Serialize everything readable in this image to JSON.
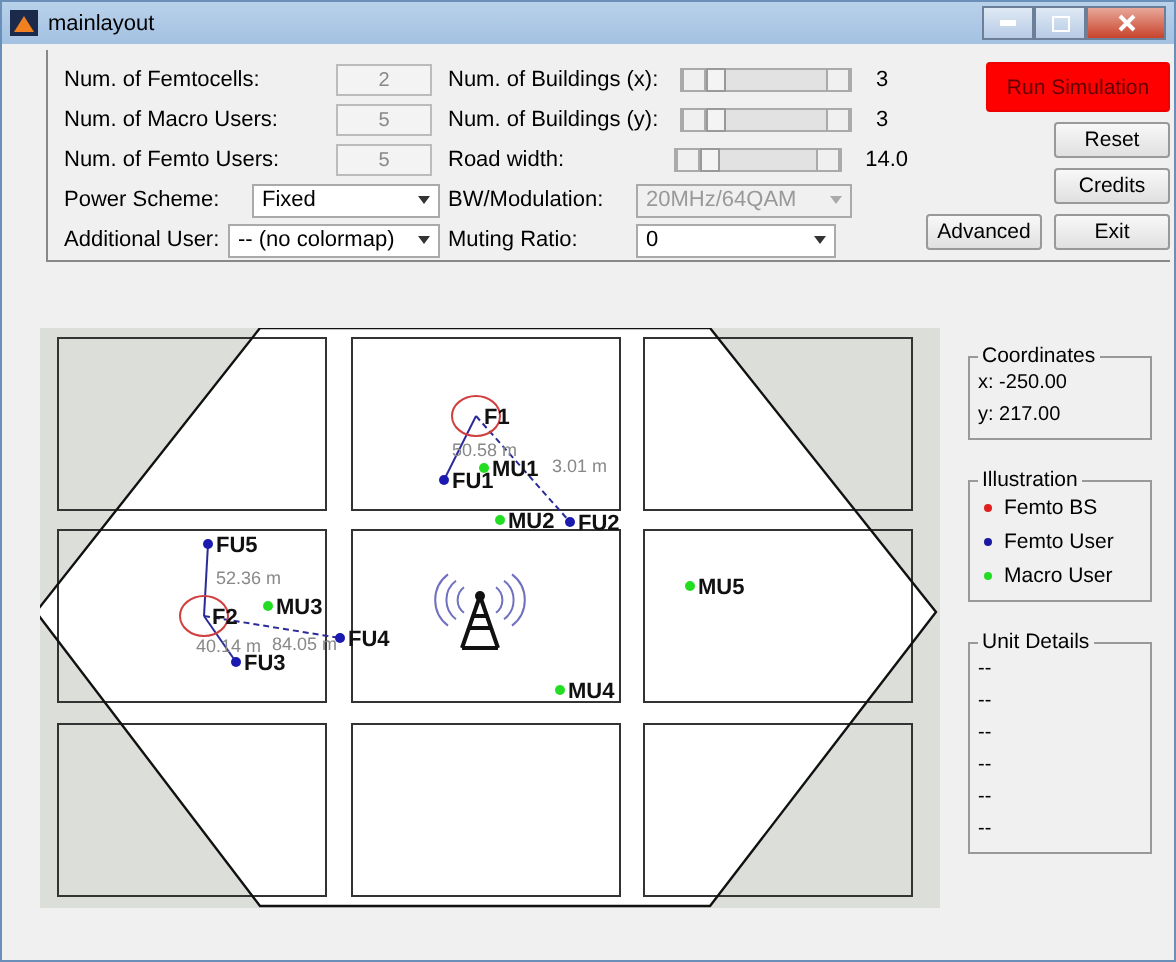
{
  "window": {
    "title": "mainlayout"
  },
  "settings_left": [
    {
      "kind": "number",
      "label": "Num. of Femtocells:",
      "value": "2",
      "disabled": true
    },
    {
      "kind": "number",
      "label": "Num. of Macro Users:",
      "value": "5",
      "disabled": true
    },
    {
      "kind": "number",
      "label": "Num. of Femto Users:",
      "value": "5",
      "disabled": true
    },
    {
      "kind": "dropdown",
      "label": "Power Scheme:",
      "value": "Fixed",
      "disabled": false
    },
    {
      "kind": "dropdown",
      "label": "Additional User:",
      "value": "-- (no colormap)",
      "disabled": false
    }
  ],
  "settings_right": [
    {
      "kind": "slider",
      "label": "Num. of Buildings (x):",
      "level": 0,
      "reading": "3"
    },
    {
      "kind": "slider",
      "label": "Num. of Buildings (y):",
      "level": 0,
      "reading": "3"
    },
    {
      "kind": "slider",
      "label": "Road width:",
      "level": 0,
      "reading": "14.0"
    },
    {
      "kind": "dropdown",
      "label": "BW/Modulation:",
      "value": "20MHz/64QAM",
      "disabled": true
    },
    {
      "kind": "dropdown",
      "label": "Muting Ratio:",
      "value": "0",
      "disabled": false
    }
  ],
  "buttons": [
    {
      "label": "Run Simulation",
      "kind": "run"
    },
    {
      "label": "Reset",
      "kind": "normal"
    },
    {
      "label": "Credits",
      "kind": "normal"
    },
    {
      "label": "Exit",
      "kind": "normal"
    }
  ],
  "advanced_button": "Advanced",
  "map": {
    "nodes": [
      {
        "label": "F1",
        "kind": "femto_bs"
      },
      {
        "label": "FU1",
        "kind": "femto_user"
      },
      {
        "label": "MU1",
        "kind": "macro_user"
      },
      {
        "label": "MU2",
        "kind": "macro_user"
      },
      {
        "label": "FU2",
        "kind": "femto_user"
      },
      {
        "label": "FU5",
        "kind": "femto_user"
      },
      {
        "label": "F2",
        "kind": "femto_bs"
      },
      {
        "label": "MU3",
        "kind": "macro_user"
      },
      {
        "label": "FU4",
        "kind": "femto_user"
      },
      {
        "label": "FU3",
        "kind": "femto_user"
      },
      {
        "label": "MU5",
        "kind": "macro_user"
      },
      {
        "label": "MU4",
        "kind": "macro_user"
      }
    ],
    "links": [
      {
        "label": "50.58 m"
      },
      {
        "label": "3.01 m"
      },
      {
        "label": "52.36 m"
      },
      {
        "label": "84.05 m"
      },
      {
        "label": "40.14 m"
      }
    ]
  },
  "coordinates": {
    "title": "Coordinates",
    "x": "x: -250.00",
    "y": "y: 217.00"
  },
  "illustration": {
    "title": "Illustration",
    "items": [
      {
        "label": "Femto BS",
        "color": "#e02020"
      },
      {
        "label": "Femto User",
        "color": "#1a1aa0"
      },
      {
        "label": "Macro User",
        "color": "#22dd22"
      }
    ]
  },
  "unit_details": {
    "title": "Unit Details",
    "lines": [
      "--",
      "--",
      "--",
      "--",
      "--",
      "--"
    ]
  }
}
